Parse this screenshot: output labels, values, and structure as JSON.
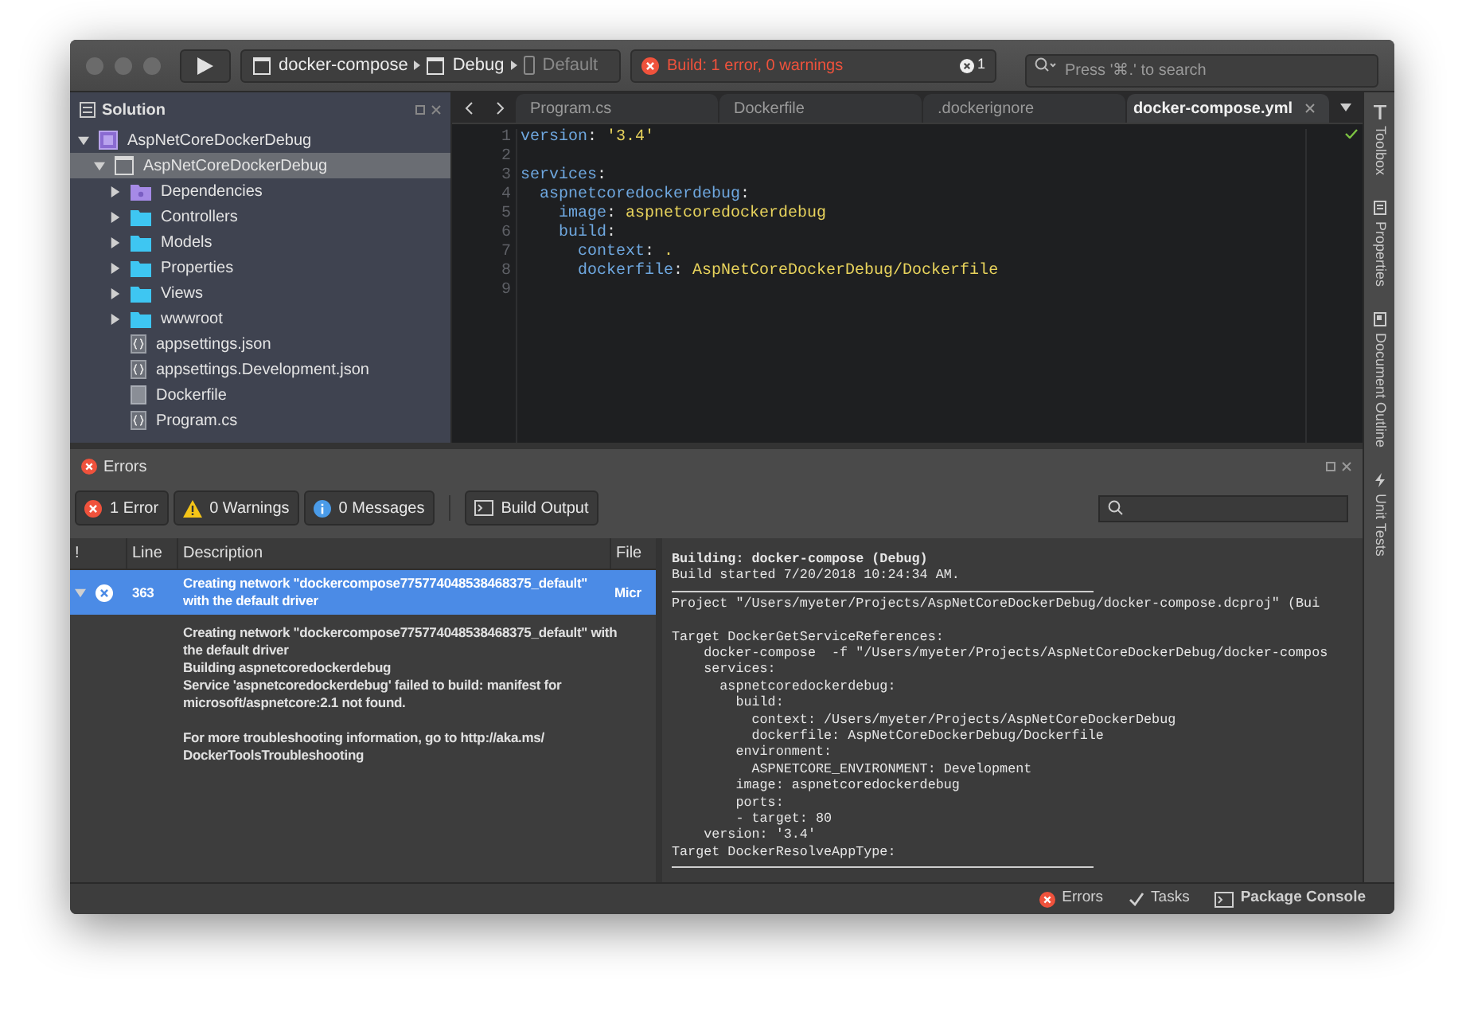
{
  "toolbar": {
    "breadcrumb": [
      {
        "label": "docker-compose",
        "kind": "project",
        "disabled": false
      },
      {
        "label": "Debug",
        "kind": "config",
        "disabled": false
      },
      {
        "label": "Default",
        "kind": "device",
        "disabled": true
      }
    ],
    "status": {
      "text": "Build: 1 error, 0 warnings",
      "count": "1"
    },
    "search": {
      "placeholder": "Press '⌘.' to search"
    }
  },
  "solution": {
    "title": "Solution",
    "tree": [
      {
        "label": "AspNetCoreDockerDebug",
        "kind": "solution",
        "expanded": true,
        "selected": false,
        "children": [
          {
            "label": "AspNetCoreDockerDebug",
            "kind": "project",
            "expanded": true,
            "selected": true,
            "children": [
              {
                "label": "Dependencies",
                "kind": "dependencies",
                "expanded": false,
                "selected": false
              },
              {
                "label": "Controllers",
                "kind": "folder",
                "expanded": false,
                "selected": false
              },
              {
                "label": "Models",
                "kind": "folder",
                "expanded": false,
                "selected": false
              },
              {
                "label": "Properties",
                "kind": "folder",
                "expanded": false,
                "selected": false
              },
              {
                "label": "Views",
                "kind": "folder",
                "expanded": false,
                "selected": false
              },
              {
                "label": "wwwroot",
                "kind": "folder",
                "expanded": false,
                "selected": false
              },
              {
                "label": "appsettings.json",
                "kind": "json",
                "selected": false
              },
              {
                "label": "appsettings.Development.json",
                "kind": "json",
                "selected": false
              },
              {
                "label": "Dockerfile",
                "kind": "file",
                "selected": false
              },
              {
                "label": "Program.cs",
                "kind": "json",
                "selected": false
              }
            ]
          }
        ]
      }
    ]
  },
  "editor": {
    "tabs": [
      {
        "label": "Program.cs",
        "selected": false
      },
      {
        "label": "Dockerfile",
        "selected": false
      },
      {
        "label": ".dockerignore",
        "selected": false
      },
      {
        "label": "docker-compose.yml",
        "selected": true
      }
    ],
    "lines": [
      {
        "number": "1",
        "key": "version",
        "colon": ":",
        "value": " '3.4'"
      },
      {
        "number": "2"
      },
      {
        "number": "3",
        "key": "services",
        "colon": ":"
      },
      {
        "number": "4",
        "key": "  aspnetcoredockerdebug",
        "colon": ":"
      },
      {
        "number": "5",
        "key": "    image",
        "colon": ":",
        "value": " aspnetcoredockerdebug"
      },
      {
        "number": "6",
        "key": "    build",
        "colon": ":"
      },
      {
        "number": "7",
        "key": "      context",
        "colon": ":",
        "value": " ."
      },
      {
        "number": "8",
        "key": "      dockerfile",
        "colon": ":",
        "value": " AspNetCoreDockerDebug/Dockerfile"
      },
      {
        "number": "9"
      }
    ]
  },
  "side_tabs": [
    "Toolbox",
    "Properties",
    "Document Outline"
  ],
  "errors_pad": {
    "title": "Errors",
    "filters": [
      {
        "label": "1 Error",
        "kind": "error"
      },
      {
        "label": "0 Warnings",
        "kind": "warning"
      },
      {
        "label": "0 Messages",
        "kind": "info"
      }
    ],
    "build_output": "Build Output",
    "columns": [
      "!",
      "Line",
      "Description",
      "File"
    ],
    "rows": [
      {
        "line": "363",
        "description": "Creating network \"dockercompose775774048538468375_default\" with the default driver",
        "file": "Micr",
        "selected": true,
        "expanded": true,
        "details": [
          "Creating network \"dockercompose775774048538468375_default\" with the default driver\nBuilding aspnetcoredockerdebug\nService 'aspnetcoredockerdebug' failed to build: manifest for microsoft/aspnetcore:2.1 not found.",
          "For more troubleshooting information, go to http://aka.ms/\nDockerToolsTroubleshooting"
        ]
      }
    ],
    "output": [
      {
        "kind": "bold",
        "text": "Building: docker-compose (Debug)"
      },
      {
        "kind": "text",
        "text": "Build started 7/20/2018 10:24:34 AM."
      },
      {
        "kind": "rule"
      },
      {
        "kind": "text",
        "text": "Project \"/Users/myeter/Projects/AspNetCoreDockerDebug/docker-compose.dcproj\" (Bui"
      },
      {
        "kind": "blank"
      },
      {
        "kind": "text",
        "text": "Target DockerGetServiceReferences:"
      },
      {
        "kind": "text",
        "text": "    docker-compose  -f \"/Users/myeter/Projects/AspNetCoreDockerDebug/docker-compos"
      },
      {
        "kind": "text",
        "text": "    services:"
      },
      {
        "kind": "text",
        "text": "      aspnetcoredockerdebug:"
      },
      {
        "kind": "text",
        "text": "        build:"
      },
      {
        "kind": "text",
        "text": "          context: /Users/myeter/Projects/AspNetCoreDockerDebug"
      },
      {
        "kind": "text",
        "text": "          dockerfile: AspNetCoreDockerDebug/Dockerfile"
      },
      {
        "kind": "text",
        "text": "        environment:"
      },
      {
        "kind": "text",
        "text": "          ASPNETCORE_ENVIRONMENT: Development"
      },
      {
        "kind": "text",
        "text": "        image: aspnetcoredockerdebug"
      },
      {
        "kind": "text",
        "text": "        ports:"
      },
      {
        "kind": "text",
        "text": "        - target: 80"
      },
      {
        "kind": "text",
        "text": "    version: '3.4'"
      },
      {
        "kind": "text",
        "text": "Target DockerResolveAppType:"
      },
      {
        "kind": "rule"
      }
    ],
    "side_tab": "Unit Tests"
  },
  "status_bar": [
    {
      "label": "Errors",
      "kind": "error"
    },
    {
      "label": "Tasks",
      "kind": "tasks"
    },
    {
      "label": "Package Console",
      "kind": "console"
    }
  ]
}
